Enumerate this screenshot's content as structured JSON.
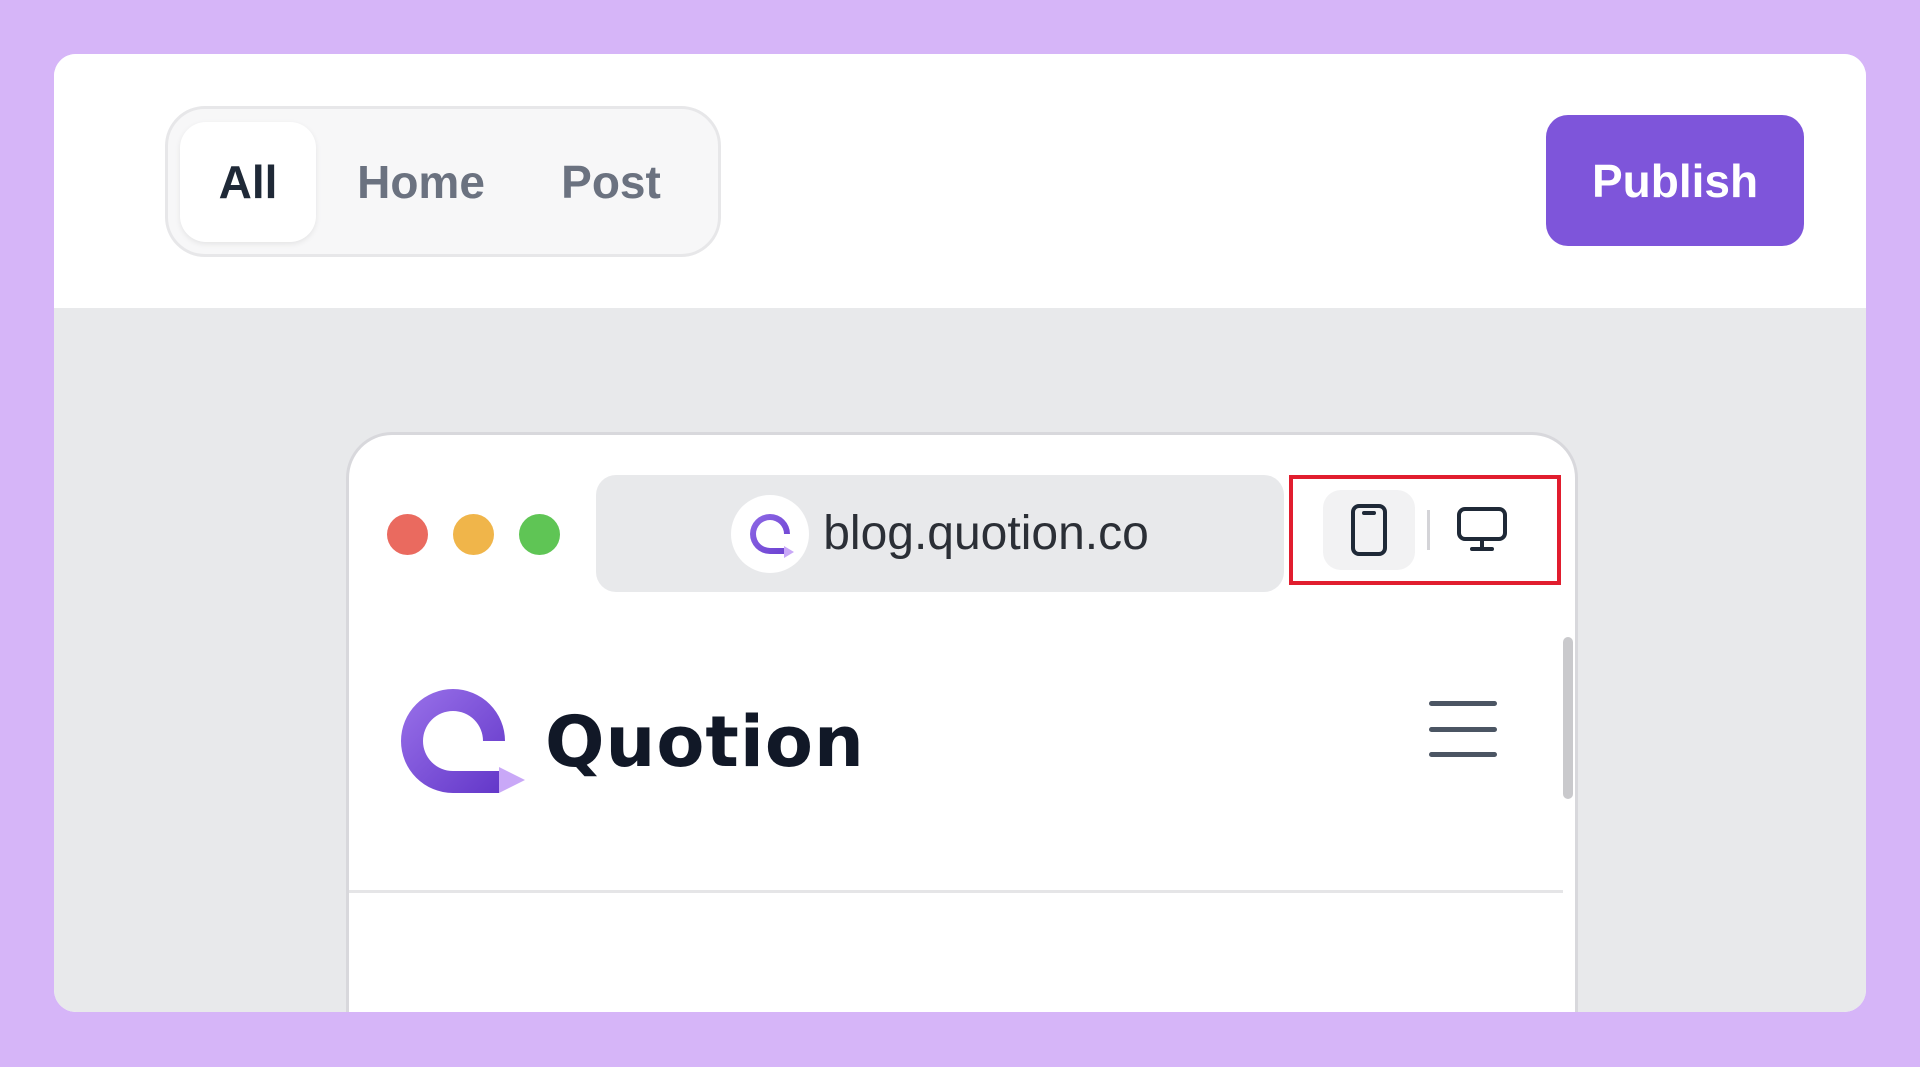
{
  "tabs": [
    {
      "label": "All",
      "active": true
    },
    {
      "label": "Home",
      "active": false
    },
    {
      "label": "Post",
      "active": false
    }
  ],
  "toolbar": {
    "publish_label": "Publish"
  },
  "preview": {
    "url": "blog.quotion.co",
    "device_options": [
      "mobile-icon",
      "desktop-icon"
    ],
    "selected_device": "mobile"
  },
  "site": {
    "name": "Quotion"
  },
  "colors": {
    "background": "#d6b5f8",
    "accent": "#7e55da",
    "highlight_box": "#e11d2e"
  }
}
